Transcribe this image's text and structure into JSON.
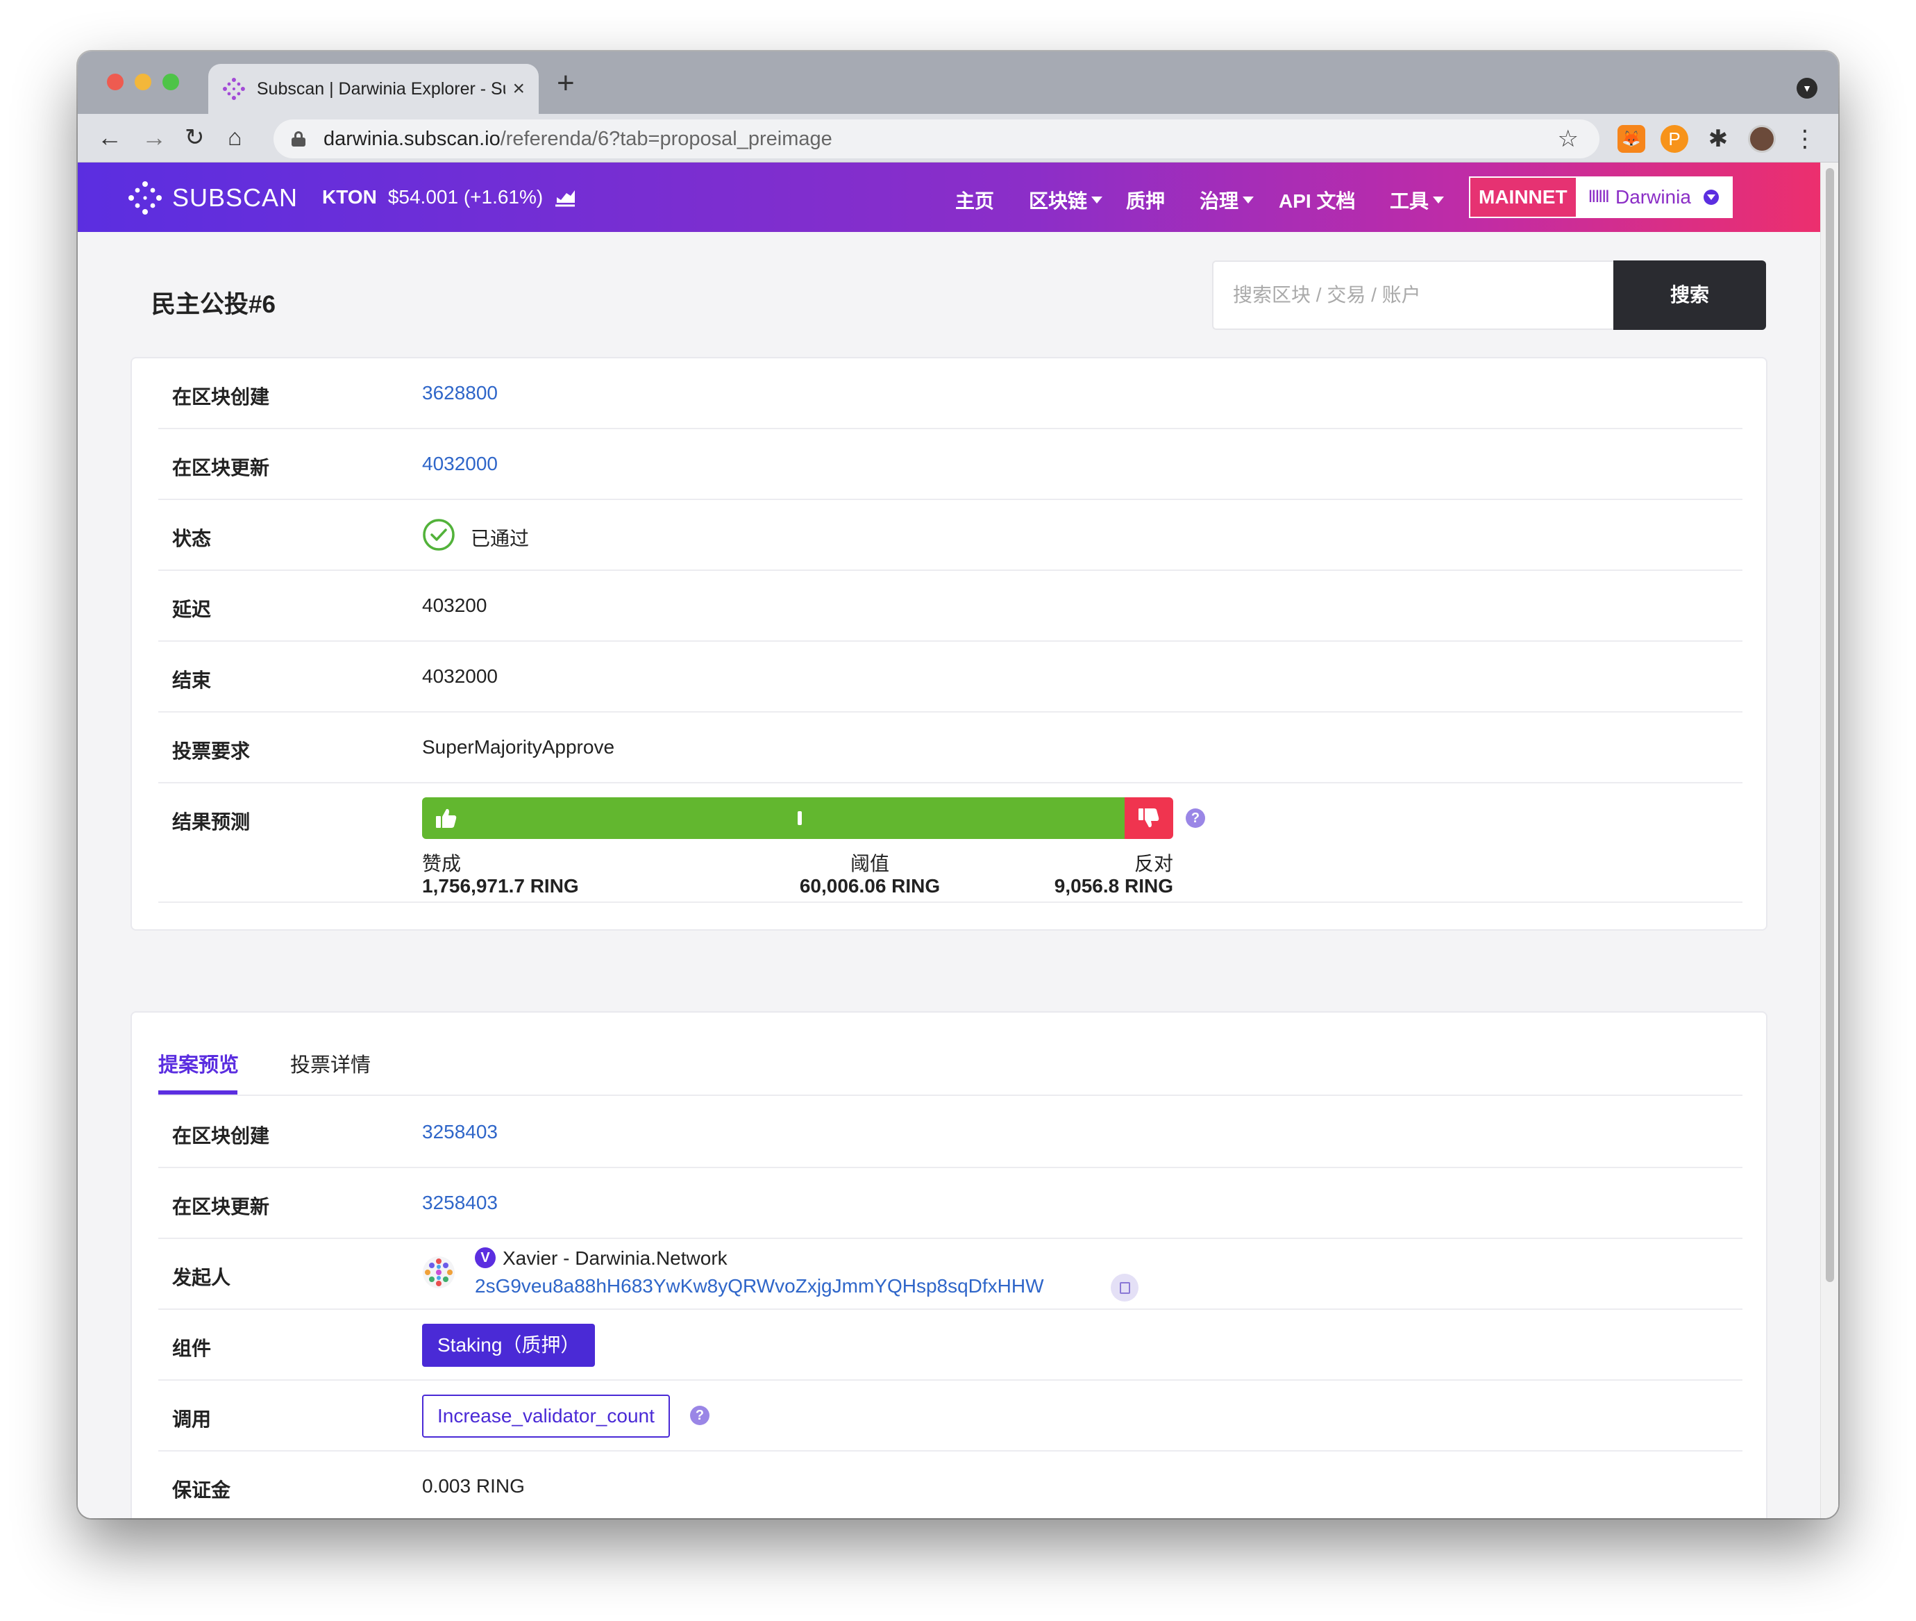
{
  "browser": {
    "tab_title": "Subscan | Darwinia Explorer - Subscan",
    "url_host": "darwinia.subscan.io",
    "url_path": "/referenda/6?tab=proposal_preimage"
  },
  "nav": {
    "brand": "SUBSCAN",
    "token_symbol": "KTON",
    "token_price": "$54.001 (+1.61%)",
    "menu": [
      "主页",
      "区块链",
      "质押",
      "治理",
      "API 文档",
      "工具"
    ],
    "network": "MAINNET",
    "chain": "Darwinia"
  },
  "page": {
    "title": "民主公投#6",
    "search_placeholder": "搜索区块 / 交易 / 账户",
    "search_button": "搜索"
  },
  "referendum": {
    "rows": [
      {
        "label": "在区块创建",
        "value": "3628800"
      },
      {
        "label": "在区块更新",
        "value": "4032000"
      },
      {
        "label": "状态",
        "value": "已通过"
      },
      {
        "label": "延迟",
        "value": "403200"
      },
      {
        "label": "结束",
        "value": "4032000"
      },
      {
        "label": "投票要求",
        "value": "SuperMajorityApprove"
      },
      {
        "label": "结果预测",
        "value": ""
      }
    ],
    "vote": {
      "aye_label": "赞成",
      "aye_amount": "1,756,971.7 RING",
      "threshold_label": "阈值",
      "threshold_amount": "60,006.06 RING",
      "nay_label": "反对",
      "nay_amount": "9,056.8 RING",
      "aye_fraction": 0.935,
      "threshold_fraction": 0.5,
      "aye_color": "#62b72f",
      "nay_color": "#f0344f"
    }
  },
  "tabs": [
    "提案预览",
    "投票详情"
  ],
  "proposal": {
    "rows": [
      {
        "label": "在区块创建",
        "value": "3258403"
      },
      {
        "label": "在区块更新",
        "value": "3258403"
      },
      {
        "label": "发起人",
        "value": ""
      },
      {
        "label": "组件",
        "value": "Staking（质押）"
      },
      {
        "label": "调用",
        "value": "Increase_validator_count"
      },
      {
        "label": "保证金",
        "value": "0.003 RING"
      }
    ],
    "proposer_badge": "V",
    "proposer_name": "Xavier - Darwinia.Network",
    "proposer_address": "2sG9veu8a88hH683YwKw8yQRWvoZxjgJmmYQHsp8sqDfxHHW"
  },
  "icons": {
    "help": "?",
    "status": "check-circle-icon"
  },
  "colors": {
    "accent": "#5b2ee0",
    "link": "#2f66c9",
    "nav_gradient_start": "#5b2ee0",
    "nav_gradient_end": "#ec2f6e"
  }
}
